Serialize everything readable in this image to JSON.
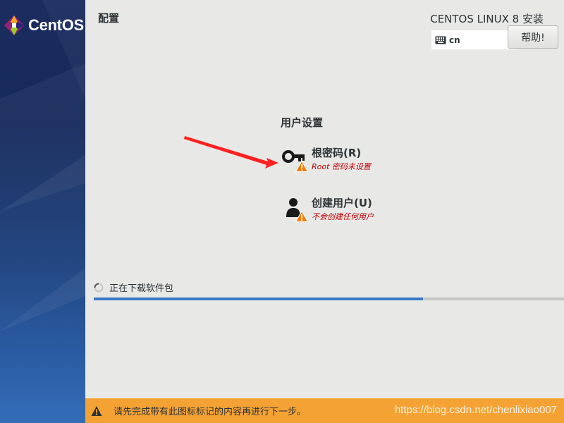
{
  "sidebar": {
    "brand": "CentOS"
  },
  "header": {
    "page_title": "配置",
    "install_title": "CENTOS LINUX 8 安装",
    "keyboard_layout": "cn",
    "help_label": "帮助!"
  },
  "user_settings": {
    "title": "用户设置",
    "spokes": [
      {
        "name": "根密码(R)",
        "status": "Root 密码未设置"
      },
      {
        "name": "创建用户(U)",
        "status": "不会创建任何用户"
      }
    ]
  },
  "progress": {
    "label": "正在下载软件包",
    "fraction": 0.7
  },
  "footer": {
    "message": "请先完成带有此图标标记的内容再进行下一步。",
    "watermark": "https://blog.csdn.net/chenlixiao007"
  },
  "colors": {
    "warning": "#f5a234",
    "status_error": "#c00000",
    "progress": "#3a78c6"
  }
}
